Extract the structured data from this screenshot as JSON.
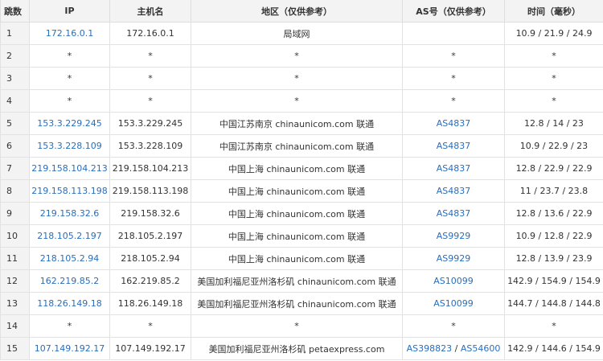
{
  "headers": {
    "hop": "跳数",
    "ip": "IP",
    "hostname": "主机名",
    "region": "地区（仅供参考）",
    "as": "AS号（仅供参考）",
    "time": "时间（毫秒）"
  },
  "rows": [
    {
      "hop": "1",
      "ip": "172.16.0.1",
      "host": "172.16.0.1",
      "region": "局域网",
      "as": [],
      "time": "10.9 / 21.9 / 24.9"
    },
    {
      "hop": "2",
      "ip": "*",
      "host": "*",
      "region": "*",
      "as": [
        "*"
      ],
      "time": "*"
    },
    {
      "hop": "3",
      "ip": "*",
      "host": "*",
      "region": "*",
      "as": [
        "*"
      ],
      "time": "*"
    },
    {
      "hop": "4",
      "ip": "*",
      "host": "*",
      "region": "*",
      "as": [
        "*"
      ],
      "time": "*"
    },
    {
      "hop": "5",
      "ip": "153.3.229.245",
      "host": "153.3.229.245",
      "region": "中国江苏南京 chinaunicom.com 联通",
      "as": [
        "AS4837"
      ],
      "time": "12.8 / 14 / 23"
    },
    {
      "hop": "6",
      "ip": "153.3.228.109",
      "host": "153.3.228.109",
      "region": "中国江苏南京 chinaunicom.com 联通",
      "as": [
        "AS4837"
      ],
      "time": "10.9 / 22.9 / 23"
    },
    {
      "hop": "7",
      "ip": "219.158.104.213",
      "host": "219.158.104.213",
      "region": "中国上海 chinaunicom.com 联通",
      "as": [
        "AS4837"
      ],
      "time": "12.8 / 22.9 / 22.9"
    },
    {
      "hop": "8",
      "ip": "219.158.113.198",
      "host": "219.158.113.198",
      "region": "中国上海 chinaunicom.com 联通",
      "as": [
        "AS4837"
      ],
      "time": "11 / 23.7 / 23.8"
    },
    {
      "hop": "9",
      "ip": "219.158.32.6",
      "host": "219.158.32.6",
      "region": "中国上海 chinaunicom.com 联通",
      "as": [
        "AS4837"
      ],
      "time": "12.8 / 13.6 / 22.9"
    },
    {
      "hop": "10",
      "ip": "218.105.2.197",
      "host": "218.105.2.197",
      "region": "中国上海 chinaunicom.com 联通",
      "as": [
        "AS9929"
      ],
      "time": "10.9 / 12.8 / 22.9"
    },
    {
      "hop": "11",
      "ip": "218.105.2.94",
      "host": "218.105.2.94",
      "region": "中国上海 chinaunicom.com 联通",
      "as": [
        "AS9929"
      ],
      "time": "12.8 / 13.9 / 23.9"
    },
    {
      "hop": "12",
      "ip": "162.219.85.2",
      "host": "162.219.85.2",
      "region": "美国加利福尼亚州洛杉矶 chinaunicom.com 联通",
      "as": [
        "AS10099"
      ],
      "time": "142.9 / 154.9 / 154.9"
    },
    {
      "hop": "13",
      "ip": "118.26.149.18",
      "host": "118.26.149.18",
      "region": "美国加利福尼亚州洛杉矶 chinaunicom.com 联通",
      "as": [
        "AS10099"
      ],
      "time": "144.7 / 144.8 / 144.8"
    },
    {
      "hop": "14",
      "ip": "*",
      "host": "*",
      "region": "*",
      "as": [
        "*"
      ],
      "time": "*"
    },
    {
      "hop": "15",
      "ip": "107.149.192.17",
      "host": "107.149.192.17",
      "region": "美国加利福尼亚州洛杉矶 petaexpress.com",
      "as": [
        "AS398823",
        "AS54600"
      ],
      "time": "142.9 / 144.6 / 154.9"
    }
  ],
  "as_separator": " / ",
  "colors": {
    "link": "#2a6ebb",
    "header_bg": "#f3f3f3",
    "border": "#e2e2e2"
  }
}
